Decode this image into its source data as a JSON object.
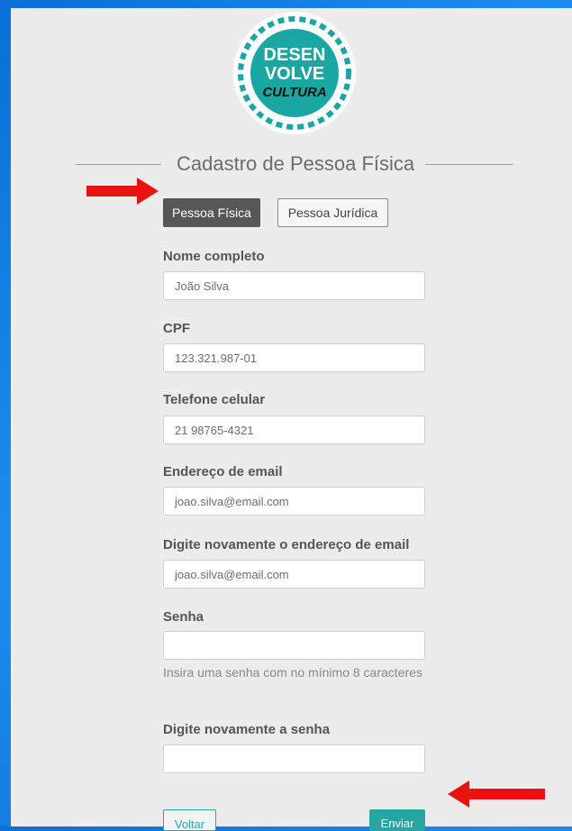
{
  "logo": {
    "line1": "DESEN",
    "line2": "VOLVE",
    "line3": "CULTURA"
  },
  "header": {
    "title": "Cadastro de Pessoa Física"
  },
  "tabs": [
    {
      "label": "Pessoa Física",
      "active": true
    },
    {
      "label": "Pessoa Jurídica",
      "active": false
    }
  ],
  "form": {
    "fields": [
      {
        "label": "Nome completo",
        "value": "João Silva"
      },
      {
        "label": "CPF",
        "value": "123.321.987-01"
      },
      {
        "label": "Telefone celular",
        "value": "21 98765-4321"
      },
      {
        "label": "Endereço de email",
        "value": "joao.silva@email.com"
      },
      {
        "label": "Digite novamente o endereço de email",
        "value": "joao.silva@email.com"
      },
      {
        "label": "Senha",
        "value": ""
      },
      {
        "label": "Digite novamente a senha",
        "value": ""
      }
    ],
    "password_help": "Insira uma senha com no mínimo 8 caracteres"
  },
  "actions": {
    "back_label": "Voltar",
    "submit_label": "Enviar"
  },
  "colors": {
    "accent": "#27a5a2",
    "arrow": "#e8130f",
    "tab_active": "#575757"
  },
  "icons": [
    "arrow-right-icon",
    "arrow-left-icon"
  ]
}
